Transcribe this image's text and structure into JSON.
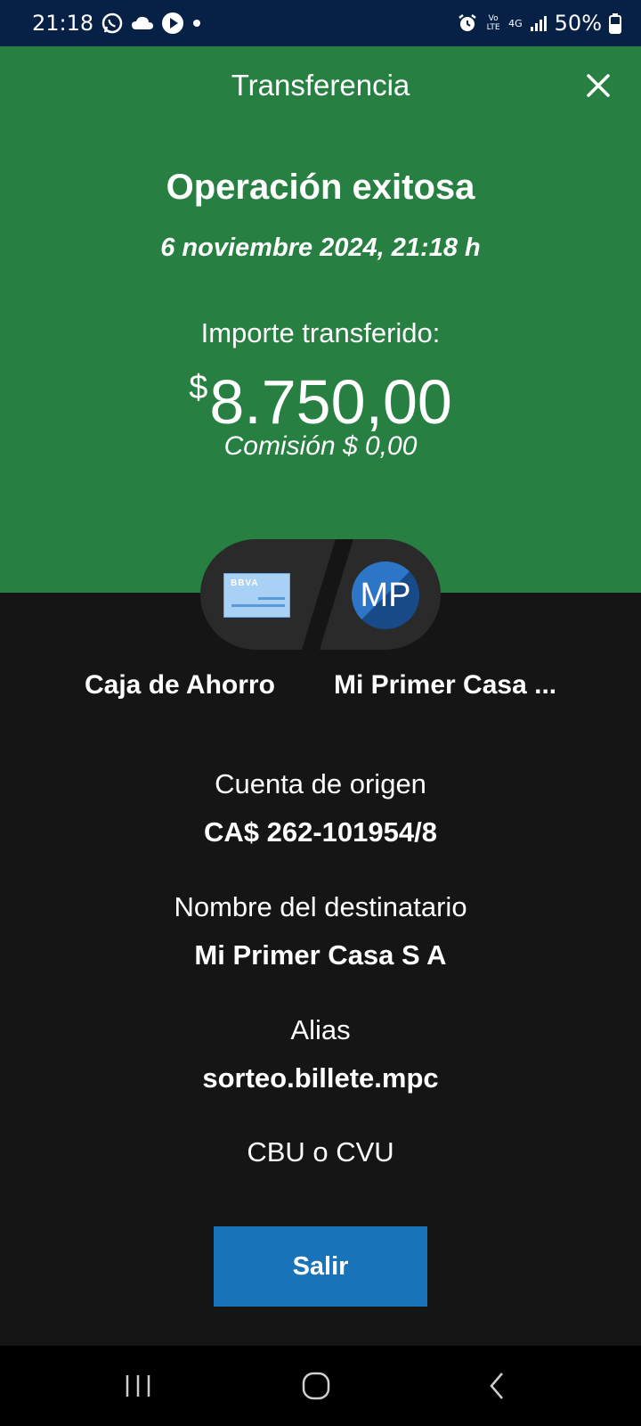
{
  "status_bar": {
    "time": "21:18",
    "battery": "50%",
    "icons_left": [
      "whatsapp-icon",
      "cloud-icon",
      "play-icon",
      "dot-icon"
    ],
    "icons_right": [
      "alarm-icon",
      "volte-icon",
      "4g-icon",
      "signal-icon",
      "battery-icon"
    ],
    "volte_text": "Vo LTE",
    "network_text": "4G"
  },
  "header": {
    "title": "Transferencia",
    "success_text": "Operación exitosa",
    "datetime": "6 noviembre 2024, 21:18 h",
    "amount_label": "Importe transferido:",
    "currency_symbol": "$",
    "amount": "8.750,00",
    "fee": "Comisión  $ 0,00",
    "bg_color": "#277f41"
  },
  "transfer": {
    "card_brand": "BBVA",
    "avatar_initials": "MP",
    "from_name": "Caja de Ahorro",
    "to_name": "Mi Primer Casa ..."
  },
  "details": {
    "origin_label": "Cuenta de origen",
    "origin_value": "CA$ 262-101954/8",
    "recipient_label": "Nombre del destinatario",
    "recipient_value": "Mi Primer Casa S A",
    "alias_label": "Alias",
    "alias_value": "sorteo.billete.mpc",
    "cbu_label": "CBU o CVU"
  },
  "actions": {
    "exit_label": "Salir",
    "button_color": "#1973b8"
  },
  "nav": {
    "items": [
      "recents-icon",
      "home-icon",
      "back-icon"
    ]
  }
}
